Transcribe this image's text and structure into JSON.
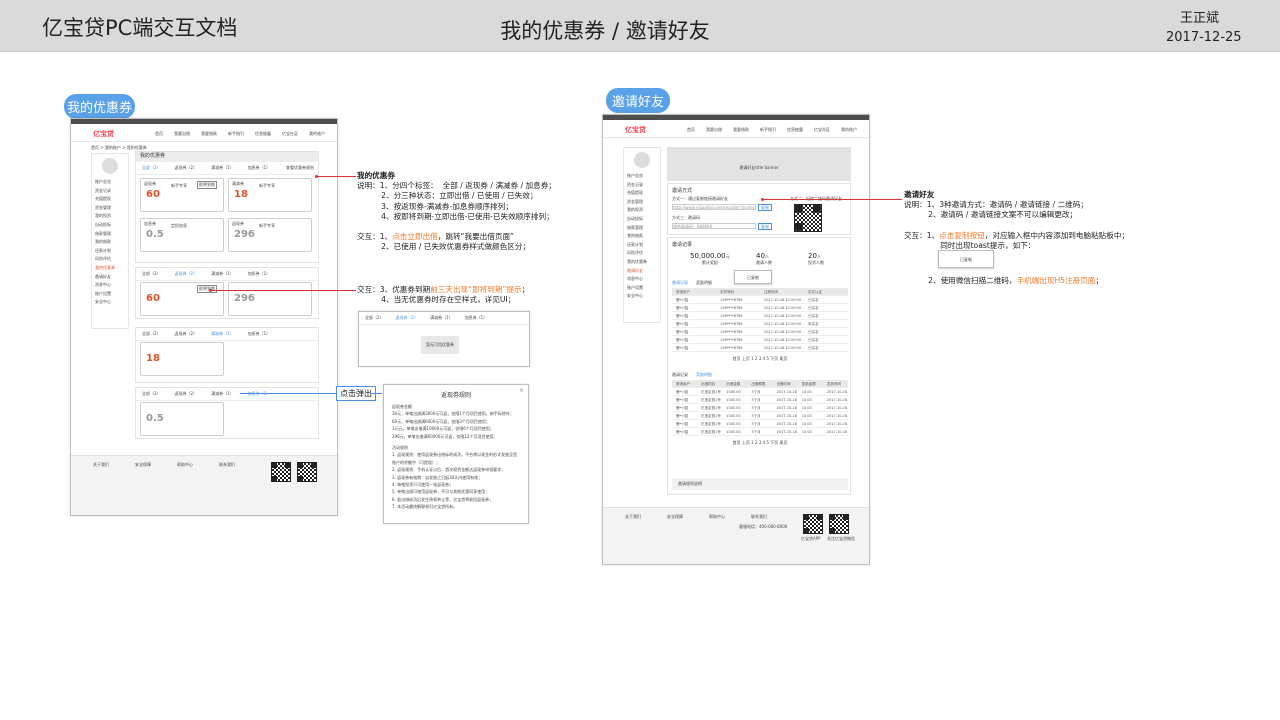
{
  "header": {
    "doc_title": "亿宝贷PC端交互文档",
    "page_title": "我的优惠券 / 邀请好友",
    "author": "王正斌",
    "date": "2017-12-25"
  },
  "left": {
    "tag": "我的优惠券",
    "site": {
      "logo": "亿宝贷",
      "nav": [
        "首页",
        "我要出借",
        "我要借款",
        "新手指引",
        "信息披露",
        "亿宝社区",
        "我的账户"
      ],
      "breadcrumb": "首页 > 我的账户 > 我的优惠券"
    },
    "sidebar": {
      "groups": [
        "账户总览",
        "资金记录",
        "充值提现",
        "资金管理",
        "我的投资",
        "自动投标",
        "借款管理",
        "我的借款",
        "还款计划",
        "风险评估",
        "我的优惠券",
        "邀请好友",
        "消息中心",
        "账户设置",
        "安全中心"
      ]
    },
    "panel_title": "我的优惠券",
    "tabs": [
      "全部（2）",
      "返现券（2）",
      "满减券（1）",
      "加息券（1）"
    ],
    "rule_link": "查看优惠券规则",
    "coupons": [
      {
        "type": "返现券",
        "value": "60",
        "unit": "元",
        "name": "新手专享",
        "btn": "立即出借",
        "badge": "即将到期"
      },
      {
        "type": "满减券",
        "value": "18",
        "unit": "元",
        "name": "新手专享",
        "btn": "立即出借"
      },
      {
        "type": "加息券",
        "value": "0.5",
        "unit": "%",
        "name": "定投加息",
        "btn": "已失效"
      },
      {
        "type": "返现券",
        "value": "296",
        "unit": "元",
        "name": "新手专享",
        "btn": "已使用"
      }
    ],
    "empty_hint": "暂无可用优惠券",
    "popup_tag": "点击弹出"
  },
  "annot_left_1": {
    "title": "我的优惠券",
    "lines": [
      "说明：1、分四个标签：  全部 / 返现券 / 满减券 / 加息券；",
      "          2、分三种状态：立即出借 / 已使用 / 已失效；",
      "          3、按返现券-满减券-加息券顺序排列；",
      "          4、按即将到期-立即出借-已使用-已失效顺序排列；"
    ],
    "inter_label": "交互：1、",
    "inter_link": "点击立即出借",
    "inter_rest": "，跳转“我要出借页面”",
    "inter_2": "          2、已使用 / 已失效优惠券样式做颜色区分；"
  },
  "annot_left_2": {
    "pre": "交互：3、优惠券到期",
    "link": "前三天出现“即将到期”提示",
    "post": "；",
    "line2": "          4、当无优惠券时存在空样式，详见UI；"
  },
  "rules_popup": {
    "title": "返现券规则",
    "sub1": "返现券金额",
    "items": [
      "30元，单笔出借满3000元可返，仅限1个月项目使用，新手标除外；",
      "60元，单笔出借满6000元可返，仅限3个月项目使用；",
      "1元元，单笔出借满10000元可返，仅限6个月项目使用；",
      "296元，单笔出借满60000元可返，仅限12个月项目使用；"
    ],
    "sub2": "活动规则",
    "rules": [
      "1. 返现规则：使用返现券出借标的成功，平台将以现金的形式发放至您账户的余额中（可提现）；",
      "2. 返现规则：手机认证以后，首次投资金额达返现券申领要求；",
      "3. 返现券有效期：自发放之日起30天内使用有效；",
      "4. 每笔投资只可使用一张返现券；",
      "5. 单笔出借可使用返现券，不可与其他优惠同享使用；",
      "6. 若出借成功后发生债权转让等，亿宝贷将收回返现券；",
      "7. 本活动最终解释权归亿宝贷所有。"
    ]
  },
  "right": {
    "tag": "邀请好友",
    "banner": "邀请好友title banner",
    "invite_title": "邀请方式",
    "invite_link_label": "方式一：通过复制链接邀请好友",
    "invite_link_value": "http://www.yibaodai.com/register?invitecode=888",
    "copy_btn": "复制",
    "way2": "方式二：扫描二维码邀请好友",
    "code_label": "方式三：邀请码",
    "code_value": "我的邀请码：888666",
    "record_title": "邀请记录",
    "stats": [
      {
        "value": "50,000.00",
        "unit": "元",
        "label": "累计奖励"
      },
      {
        "value": "40",
        "unit": "人",
        "label": "邀请人数"
      },
      {
        "value": "20",
        "unit": "人",
        "label": "投资人数"
      }
    ],
    "toast": "已复制",
    "table_tabs": [
      "邀请记录",
      "奖励明细"
    ],
    "table1_head": [
      "邀请用户",
      "手机号码",
      "注册时间",
      "实名认证"
    ],
    "table1_rows": [
      [
        "鹿*小姐",
        "138****8765",
        "2017-10-18 12:00:00",
        "已实名"
      ],
      [
        "鹿*小姐",
        "138****8765",
        "2017-10-18 12:00:00",
        "已实名"
      ],
      [
        "鹿*小姐",
        "138****8765",
        "2017-10-18 12:00:00",
        "已实名"
      ],
      [
        "鹿*小姐",
        "138****8765",
        "2017-10-18 12:00:00",
        "未实名"
      ],
      [
        "鹿*小姐",
        "138****8765",
        "2017-10-18 12:00:00",
        "已实名"
      ],
      [
        "鹿*小姐",
        "138****8765",
        "2017-10-18 12:00:00",
        "已实名"
      ],
      [
        "鹿*小姐",
        "138****8765",
        "2017-10-18 12:00:00",
        "已实名"
      ]
    ],
    "table2_head": [
      "邀请用户",
      "出借项目",
      "出借金额",
      "出借期限",
      "出借时间",
      "奖励金额",
      "发放时间"
    ],
    "table2_rows": [
      [
        "鹿*小姐",
        "亿宝定投1号",
        "1000.00",
        "3个月",
        "2017-10-18",
        "10.00",
        "2017-10-18"
      ],
      [
        "鹿*小姐",
        "亿宝定投1号",
        "1000.00",
        "3个月",
        "2017-10-18",
        "10.00",
        "2017-10-18"
      ],
      [
        "鹿*小姐",
        "亿宝定投1号",
        "1000.00",
        "3个月",
        "2017-10-18",
        "10.00",
        "2017-10-18"
      ],
      [
        "鹿*小姐",
        "亿宝定投1号",
        "1000.00",
        "3个月",
        "2017-10-18",
        "10.00",
        "2017-10-18"
      ],
      [
        "鹿*小姐",
        "亿宝定投1号",
        "1000.00",
        "3个月",
        "2017-10-18",
        "10.00",
        "2017-10-18"
      ],
      [
        "鹿*小姐",
        "亿宝定投1号",
        "1000.00",
        "3个月",
        "2017-10-18",
        "10.00",
        "2017-10-18"
      ]
    ],
    "pager": "首页 上页 1 2 3 4 5 下页 尾页",
    "note": "邀请规则说明"
  },
  "annot_right": {
    "title": "邀请好友",
    "l1": "说明：1、3种邀请方式：邀请码 / 邀请链接 / 二维码；",
    "l2": "          2、邀请码 / 邀请链接文案不可以编辑更改；",
    "i1_pre": "交互：1、",
    "i1_link": "点击复制按钮",
    "i1_post": "，对应输入框中内容添加到电脑粘贴板中；",
    "i1_l2": "               同时出现toast提示，如下：",
    "toast": "已复制",
    "i2_pre": "          2、使用微信扫描二维码，",
    "i2_link": "手机端出现H5注册页面",
    "i2_post": "；"
  },
  "footer": {
    "cols": [
      "关于我们",
      "安全保障",
      "帮助中心",
      "联系我们"
    ],
    "phone": "客服电话：400-000-8000",
    "qr_labels": [
      "亿宝贷APP",
      "关注亿宝贷微信"
    ]
  }
}
